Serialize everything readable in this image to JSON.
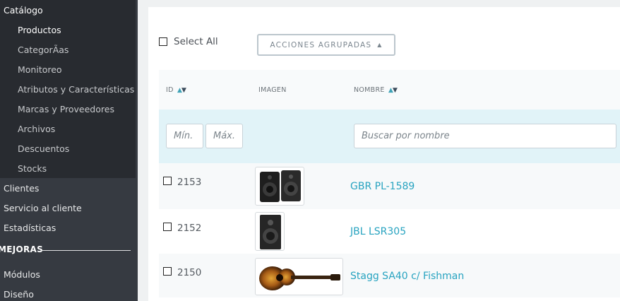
{
  "sidebar": {
    "catalog_label": "Catálogo",
    "sub_items": [
      {
        "label": "Productos"
      },
      {
        "label": "CategorÃas"
      },
      {
        "label": "Monitoreo"
      },
      {
        "label": "Atributos y Características"
      },
      {
        "label": "Marcas y Proveedores"
      },
      {
        "label": "Archivos"
      },
      {
        "label": "Descuentos"
      },
      {
        "label": "Stocks"
      }
    ],
    "items": [
      {
        "label": "Clientes"
      },
      {
        "label": "Servicio al cliente"
      },
      {
        "label": "Estadísticas"
      }
    ],
    "section_header": "MEJORAS",
    "section_items": [
      {
        "label": "Módulos"
      },
      {
        "label": "Diseño"
      }
    ]
  },
  "toolbar": {
    "select_all_label": "Select All",
    "bulk_actions_label": "ACCIONES AGRUPADAS"
  },
  "table": {
    "columns": {
      "id": "ID",
      "image": "IMAGEN",
      "name": "NOMBRE"
    },
    "filters": {
      "id_min_placeholder": "Mín.",
      "id_max_placeholder": "Máx.",
      "name_placeholder": "Buscar por nombre"
    },
    "rows": [
      {
        "id": "2153",
        "name": "GBR PL-1589",
        "image": "speakers-pair"
      },
      {
        "id": "2152",
        "name": "JBL LSR305",
        "image": "studio-monitor"
      },
      {
        "id": "2150",
        "name": "Stagg SA40 c/ Fishman",
        "image": "acoustic-guitar"
      }
    ]
  },
  "colors": {
    "sidebar_bg": "#363a41",
    "sidebar_active_bg": "#282b30",
    "link": "#27a3c0",
    "filter_row_bg": "#e1f3f8"
  }
}
